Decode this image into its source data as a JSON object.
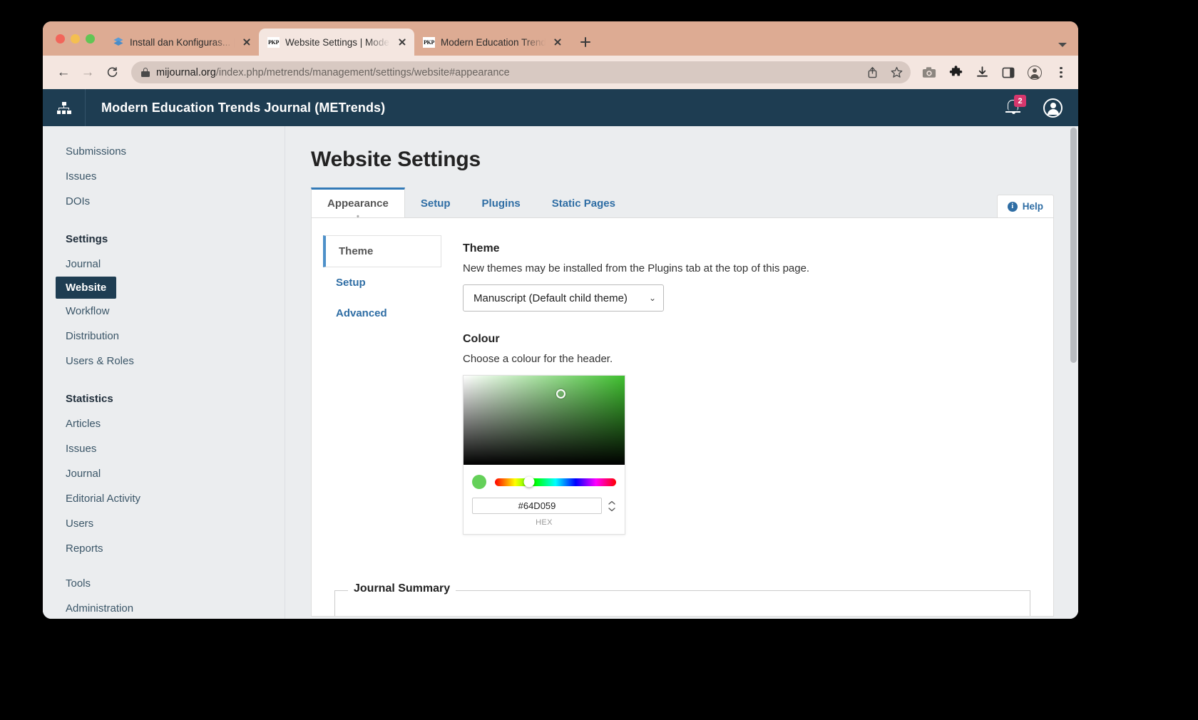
{
  "browser": {
    "tabs": [
      {
        "title": "Install dan Konfiguras... | Book",
        "favicon": "book-stack-icon",
        "active": false
      },
      {
        "title": "Website Settings | Modern Edu",
        "favicon": "pkp-icon",
        "active": true
      },
      {
        "title": "Modern Education Trends Jour",
        "favicon": "pkp-icon",
        "active": false
      }
    ],
    "new_tab_label": "+",
    "url_domain": "mijournal.org",
    "url_path": "/index.php/metrends/management/settings/website#appearance",
    "toolbar_icons": [
      "back-arrow-icon",
      "forward-arrow-icon",
      "reload-icon",
      "lock-icon",
      "share-icon",
      "star-icon",
      "camera-icon",
      "extensions-puzzle-icon",
      "download-icon",
      "sidepanel-icon",
      "profile-icon",
      "kebab-menu-icon"
    ]
  },
  "ojs_header": {
    "logo_icon": "sitemap-icon",
    "journal_title": "Modern Education Trends Journal (METrends)",
    "notification_count": "2",
    "bell_icon": "bell-icon",
    "avatar_icon": "user-avatar-icon"
  },
  "sidebar": {
    "top_items": [
      {
        "label": "Submissions"
      },
      {
        "label": "Issues"
      },
      {
        "label": "DOIs"
      }
    ],
    "settings_heading": "Settings",
    "settings_items": [
      {
        "label": "Journal",
        "active": false
      },
      {
        "label": "Website",
        "active": true
      },
      {
        "label": "Workflow",
        "active": false
      },
      {
        "label": "Distribution",
        "active": false
      },
      {
        "label": "Users & Roles",
        "active": false
      }
    ],
    "statistics_heading": "Statistics",
    "statistics_items": [
      {
        "label": "Articles"
      },
      {
        "label": "Issues"
      },
      {
        "label": "Journal"
      },
      {
        "label": "Editorial Activity"
      },
      {
        "label": "Users"
      },
      {
        "label": "Reports"
      }
    ],
    "bottom_items": [
      {
        "label": "Tools"
      },
      {
        "label": "Administration"
      }
    ]
  },
  "main": {
    "page_title": "Website Settings",
    "tabs": [
      {
        "label": "Appearance",
        "active": true
      },
      {
        "label": "Setup",
        "active": false
      },
      {
        "label": "Plugins",
        "active": false
      },
      {
        "label": "Static Pages",
        "active": false
      }
    ],
    "help_label": "Help",
    "help_icon": "info-icon",
    "vertical_tabs": [
      {
        "label": "Theme",
        "active": true
      },
      {
        "label": "Setup",
        "active": false
      },
      {
        "label": "Advanced",
        "active": false
      }
    ],
    "theme": {
      "label": "Theme",
      "description": "New themes may be installed from the Plugins tab at the top of this page.",
      "selected": "Manuscript (Default child theme)",
      "chevron_icon": "chevron-down-icon"
    },
    "colour": {
      "label": "Colour",
      "description": "Choose a colour for the header.",
      "hex_value": "#64D059",
      "hex_caption": "HEX",
      "swatch_color": "#64D059",
      "stepper_icon": "stepper-updown-icon"
    },
    "journal_summary_legend": "Journal Summary"
  }
}
